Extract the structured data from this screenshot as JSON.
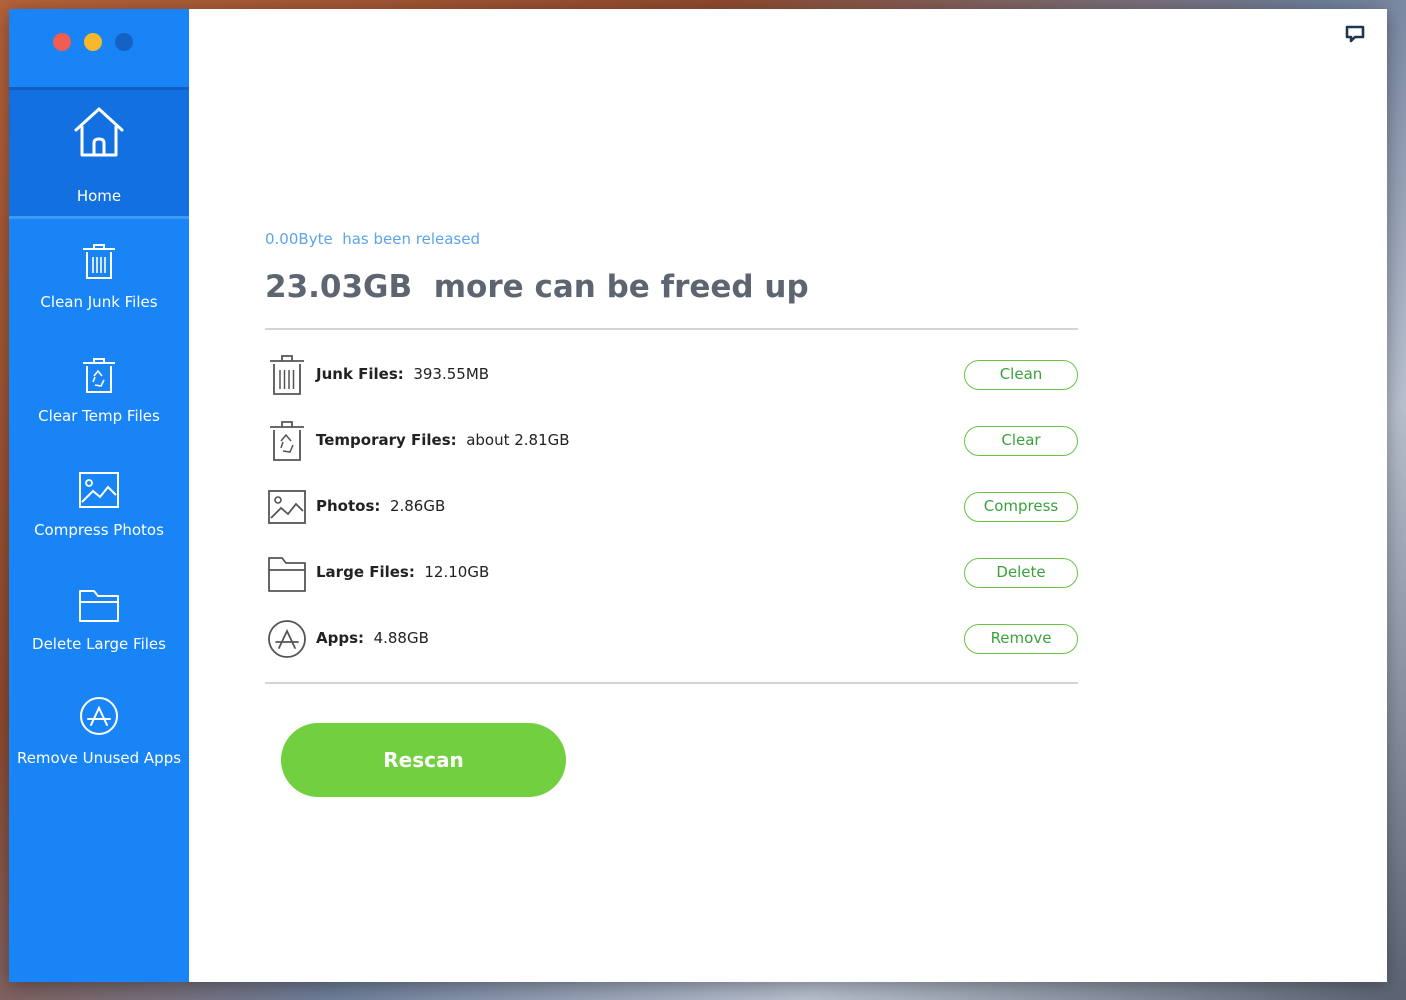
{
  "sidebar": {
    "items": [
      {
        "label": "Home",
        "icon": "home-icon"
      },
      {
        "label": "Clean Junk Files",
        "icon": "trash-icon"
      },
      {
        "label": "Clear Temp Files",
        "icon": "recycle-bin-icon"
      },
      {
        "label": "Compress Photos",
        "icon": "photo-icon"
      },
      {
        "label": "Delete Large Files",
        "icon": "folder-icon"
      },
      {
        "label": "Remove Unused Apps",
        "icon": "app-store-icon"
      }
    ]
  },
  "status": {
    "released_amount": "0.00Byte",
    "released_text": "has been released",
    "free_amount": "23.03GB",
    "free_text": "more can be freed up"
  },
  "rows": [
    {
      "label": "Junk Files:",
      "value": "393.55MB",
      "button": "Clean",
      "icon": "trash-icon"
    },
    {
      "label": "Temporary Files:",
      "value": "about 2.81GB",
      "button": "Clear",
      "icon": "recycle-bin-icon"
    },
    {
      "label": "Photos:",
      "value": "2.86GB",
      "button": "Compress",
      "icon": "photo-icon"
    },
    {
      "label": "Large Files:",
      "value": "12.10GB",
      "button": "Delete",
      "icon": "folder-icon"
    },
    {
      "label": "Apps:",
      "value": "4.88GB",
      "button": "Remove",
      "icon": "app-store-icon"
    }
  ],
  "actions": {
    "rescan_label": "Rescan"
  },
  "colors": {
    "sidebar": "#1884f5",
    "sidebar_active": "#1370e0",
    "accent_green": "#72cf3f",
    "button_border": "#69c243",
    "released_text": "#5ba5e8",
    "headline": "#5d6570"
  }
}
